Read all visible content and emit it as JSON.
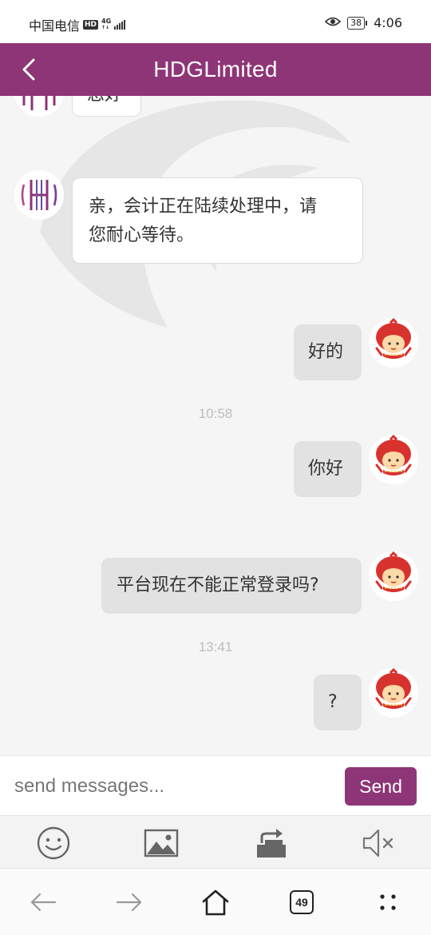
{
  "status_bar": {
    "carrier": "中国电信",
    "hd_badge": "HD",
    "network_top": "4G",
    "network_bottom": "↑↓",
    "battery_level": "38",
    "time": "4:06"
  },
  "header": {
    "title": "HDGLimited"
  },
  "messages": [
    {
      "side": "in",
      "text": "您好"
    },
    {
      "side": "in",
      "text_line1": "亲，会计正在陆续处理中，请",
      "text_line2": "您耐心等待。"
    },
    {
      "side": "out",
      "text": "好的"
    },
    {
      "timestamp": "10:58"
    },
    {
      "side": "out",
      "text": "你好"
    },
    {
      "side": "out",
      "text": "平台现在不能正常登录吗?"
    },
    {
      "timestamp": "13:41"
    },
    {
      "side": "out",
      "text": "?"
    }
  ],
  "input_bar": {
    "placeholder": "send messages...",
    "send_label": "Send"
  },
  "tool_bar": {
    "icons": [
      "emoji-icon",
      "image-icon",
      "share-icon",
      "mute-icon"
    ]
  },
  "nav_bar": {
    "tab_count": "49"
  },
  "colors": {
    "brand": "#8e3577",
    "background": "#f5f5f5",
    "bubble_out": "#e2e2e2"
  }
}
